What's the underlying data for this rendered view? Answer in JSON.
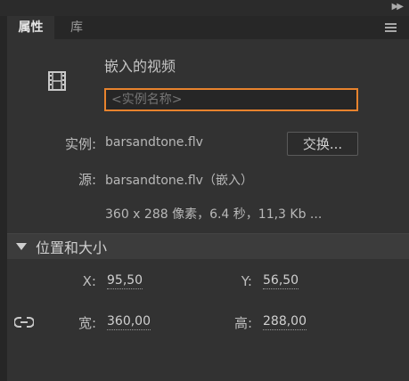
{
  "tabs": {
    "properties": "属性",
    "library": "库"
  },
  "instance": {
    "type_label": "嵌入的视频",
    "name_placeholder": "<实例名称>"
  },
  "details": {
    "instance_label": "实例:",
    "instance_value": "barsandtone.flv",
    "swap_button": "交换...",
    "source_label": "源:",
    "source_value": "barsandtone.flv（嵌入）",
    "meta": "360 x 288 像素，6.4 秒，11,3 Kb ..."
  },
  "position_size": {
    "title": "位置和大小",
    "x_label": "X:",
    "x_value": "95,50",
    "y_label": "Y:",
    "y_value": "56,50",
    "width_label": "宽:",
    "width_value": "360,00",
    "height_label": "高:",
    "height_value": "288,00"
  },
  "colors": {
    "accent": "#e8832d",
    "panel_bg": "#323232"
  },
  "icons": [
    "collapse-arrows-icon",
    "panel-menu-icon",
    "film-icon",
    "section-collapse-icon",
    "link-constraint-icon"
  ]
}
